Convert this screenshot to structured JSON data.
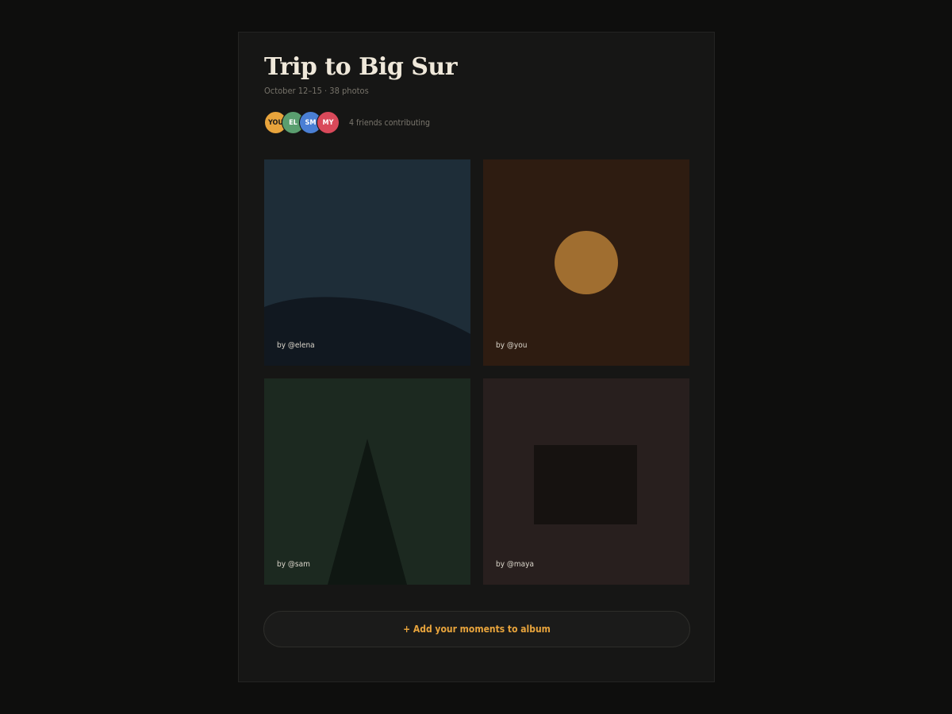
{
  "album": {
    "title": "Trip to Big Sur",
    "subtitle": "October 12–15 · 38 photos"
  },
  "contributors": {
    "avatars": [
      {
        "initials": "YOU",
        "color": "#e8a43c",
        "text_color": "#1a1a1a"
      },
      {
        "initials": "EL",
        "color": "#5a9e6f",
        "text_color": "#ffffff"
      },
      {
        "initials": "SM",
        "color": "#4a7fd4",
        "text_color": "#ffffff"
      },
      {
        "initials": "MY",
        "color": "#d9495a",
        "text_color": "#ffffff"
      }
    ],
    "summary": "4 friends contributing"
  },
  "photos": [
    {
      "credit": "by @elena",
      "background": "#1e2d38",
      "shape_color": "#111820",
      "scene": "hill"
    },
    {
      "credit": "by @you",
      "background": "#2e1c11",
      "shape_color": "#a06e30",
      "scene": "sun"
    },
    {
      "credit": "by @sam",
      "background": "#1c2920",
      "shape_color": "#0f1712",
      "scene": "tree"
    },
    {
      "credit": "by @maya",
      "background": "#281f1e",
      "shape_color": "#161210",
      "scene": "frame"
    }
  ],
  "actions": {
    "add_label": "+ Add your moments to album"
  },
  "colors": {
    "accent": "#e8a43c",
    "page_background": "#0e0e0d",
    "card_background": "#161615"
  }
}
